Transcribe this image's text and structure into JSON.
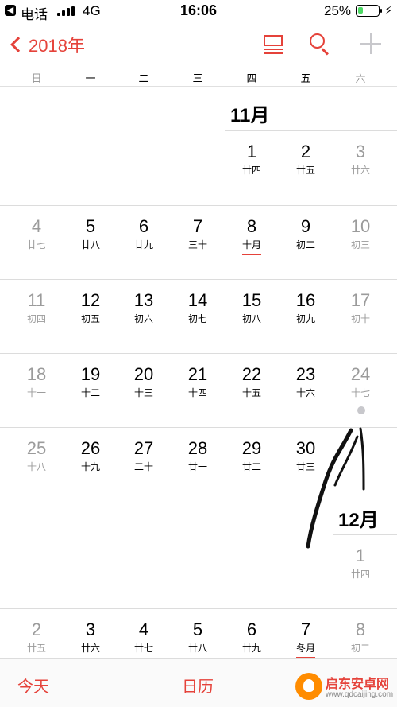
{
  "status_bar": {
    "carrier": "电话",
    "network": "4G",
    "time": "16:06",
    "battery_percent": "25%",
    "battery_level": 0.25
  },
  "nav": {
    "back_label": "2018年"
  },
  "weekdays": [
    "日",
    "一",
    "二",
    "三",
    "四",
    "五",
    "六"
  ],
  "months": {
    "nov": "11月",
    "dec": "12月"
  },
  "days": [
    {
      "num": "1",
      "lunar": "廿四"
    },
    {
      "num": "2",
      "lunar": "廿五"
    },
    {
      "num": "3",
      "lunar": "廿六"
    },
    {
      "num": "4",
      "lunar": "廿七"
    },
    {
      "num": "5",
      "lunar": "廿八"
    },
    {
      "num": "6",
      "lunar": "廿九"
    },
    {
      "num": "7",
      "lunar": "三十"
    },
    {
      "num": "8",
      "lunar": "十月"
    },
    {
      "num": "9",
      "lunar": "初二"
    },
    {
      "num": "10",
      "lunar": "初三"
    },
    {
      "num": "11",
      "lunar": "初四"
    },
    {
      "num": "12",
      "lunar": "初五"
    },
    {
      "num": "13",
      "lunar": "初六"
    },
    {
      "num": "14",
      "lunar": "初七"
    },
    {
      "num": "15",
      "lunar": "初八"
    },
    {
      "num": "16",
      "lunar": "初九"
    },
    {
      "num": "17",
      "lunar": "初十"
    },
    {
      "num": "18",
      "lunar": "十一"
    },
    {
      "num": "19",
      "lunar": "十二"
    },
    {
      "num": "20",
      "lunar": "十三"
    },
    {
      "num": "21",
      "lunar": "十四"
    },
    {
      "num": "22",
      "lunar": "十五"
    },
    {
      "num": "23",
      "lunar": "十六"
    },
    {
      "num": "24",
      "lunar": "十七"
    },
    {
      "num": "25",
      "lunar": "十八"
    },
    {
      "num": "26",
      "lunar": "十九"
    },
    {
      "num": "27",
      "lunar": "二十"
    },
    {
      "num": "28",
      "lunar": "廿一"
    },
    {
      "num": "29",
      "lunar": "廿二"
    },
    {
      "num": "30",
      "lunar": "廿三"
    },
    {
      "num": "1",
      "lunar": "廿四"
    },
    {
      "num": "2",
      "lunar": "廿五"
    },
    {
      "num": "3",
      "lunar": "廿六"
    },
    {
      "num": "4",
      "lunar": "廿七"
    },
    {
      "num": "5",
      "lunar": "廿八"
    },
    {
      "num": "6",
      "lunar": "廿九"
    },
    {
      "num": "7",
      "lunar": "冬月"
    },
    {
      "num": "8",
      "lunar": "初二"
    }
  ],
  "tab_bar": {
    "today": "今天",
    "calendars": "日历"
  },
  "watermark": {
    "title": "启东安卓网",
    "url": "www.qdcaijing.com"
  },
  "colors": {
    "accent": "#e5423a",
    "weekend_text": "#9b9b9b",
    "battery": "#4cd964"
  }
}
